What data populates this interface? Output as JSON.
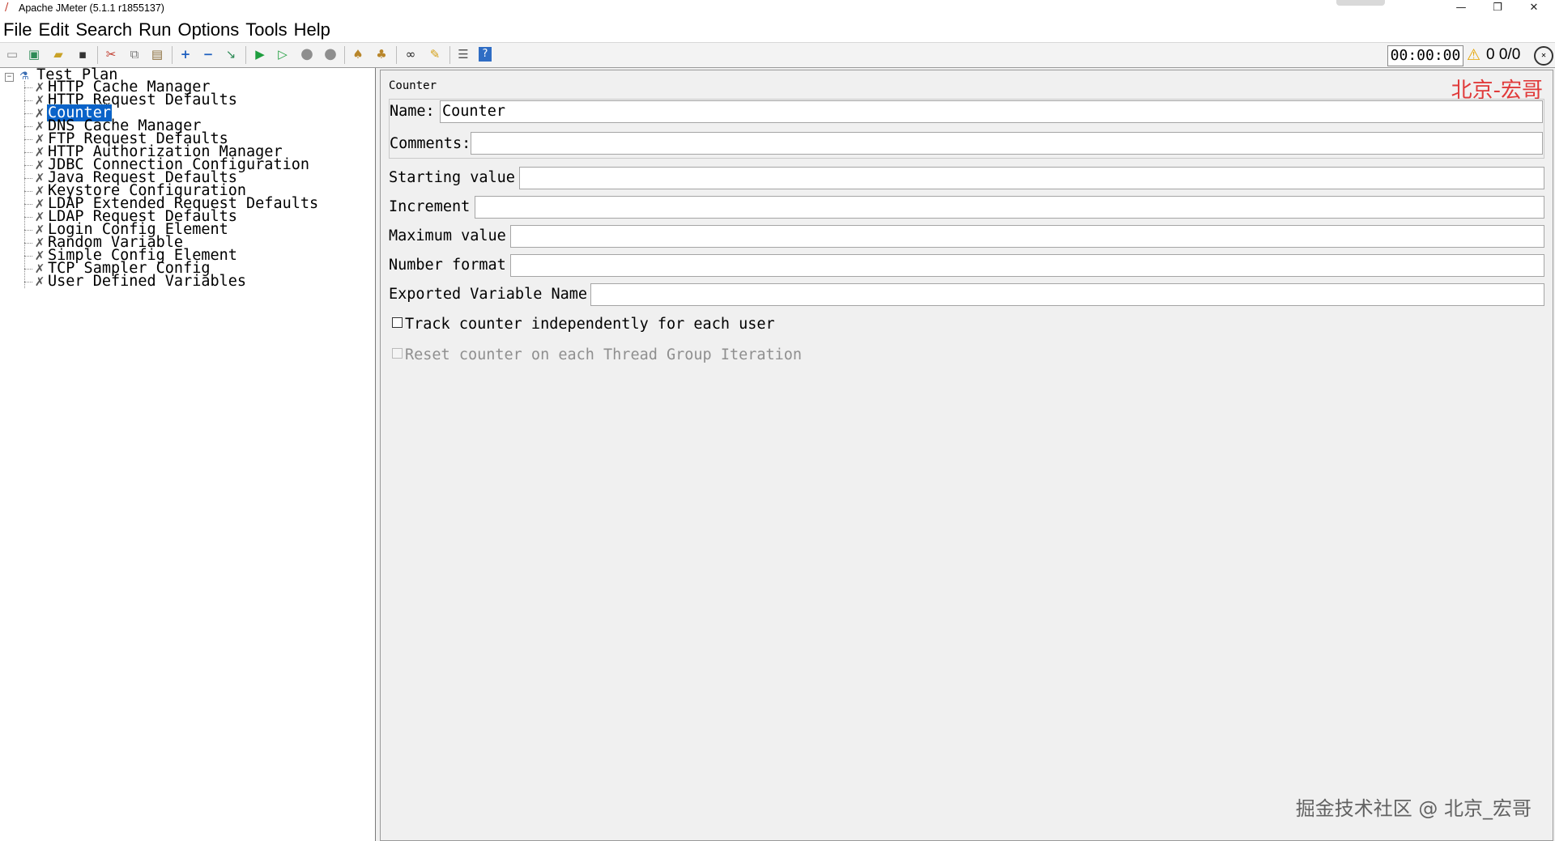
{
  "window": {
    "title": "Apache JMeter (5.1.1 r1855137)",
    "controls": {
      "minimize": "—",
      "restore": "❐",
      "close": "✕"
    }
  },
  "menu": [
    "File",
    "Edit",
    "Search",
    "Run",
    "Options",
    "Tools",
    "Help"
  ],
  "toolbar": {
    "icons": [
      "new-icon",
      "templates-icon",
      "open-icon",
      "save-icon",
      "cut-icon",
      "copy-icon",
      "paste-icon",
      "expand-icon",
      "collapse-icon",
      "toggle-icon",
      "start-icon",
      "start-no-pause-icon",
      "stop-icon",
      "shutdown-icon",
      "clear-icon",
      "clear-all-icon",
      "search-icon",
      "reset-search-icon",
      "function-helper-icon",
      "help-icon"
    ],
    "timer": "00:00:00",
    "warning_count": "0",
    "thread_counts": "0/0"
  },
  "tree": {
    "root": "Test Plan",
    "items": [
      "HTTP Cache Manager",
      "HTTP Request Defaults",
      "Counter",
      "DNS Cache Manager",
      "FTP Request Defaults",
      "HTTP Authorization Manager",
      "JDBC Connection Configuration",
      "Java Request Defaults",
      "Keystore Configuration",
      "LDAP Extended Request Defaults",
      "LDAP Request Defaults",
      "Login Config Element",
      "Random Variable",
      "Simple Config Element",
      "TCP Sampler Config",
      "User Defined Variables"
    ],
    "selected": "Counter"
  },
  "panel": {
    "title": "Counter",
    "watermark": "北京-宏哥",
    "name_label": "Name:",
    "name_value": "Counter",
    "comments_label": "Comments:",
    "comments_value": "",
    "starting_value_label": "Starting value",
    "starting_value": "",
    "increment_label": "Increment",
    "increment_value": "",
    "maximum_value_label": "Maximum value",
    "maximum_value": "",
    "number_format_label": "Number format",
    "number_format_value": "",
    "exported_variable_label": "Exported Variable Name",
    "exported_variable_value": "",
    "track_counter_label": "Track counter independently for each user",
    "reset_counter_label": "Reset counter on each Thread Group Iteration"
  },
  "footer_watermark": "掘金技术社区 @ 北京_宏哥"
}
